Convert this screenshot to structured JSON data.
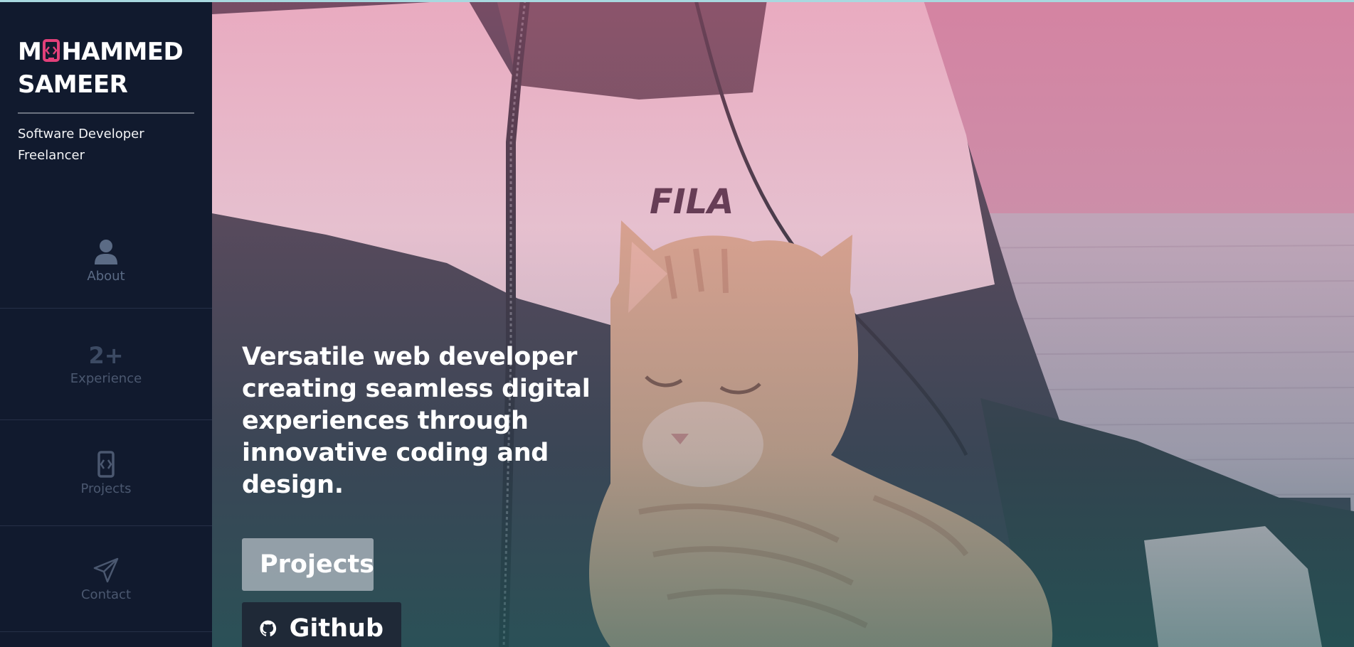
{
  "brand": {
    "name_line1_before": "M",
    "name_line1_after": "HAMMED",
    "name_line2": "SAMEER",
    "role_line1": "Software Developer",
    "role_line2": "Freelancer",
    "accent_color": "#e2407a"
  },
  "nav": {
    "about": {
      "label": "About",
      "icon": "user-icon"
    },
    "experience": {
      "stat": "2+",
      "label": "Experience"
    },
    "projects": {
      "label": "Projects",
      "icon": "code-device-icon"
    },
    "contact": {
      "label": "Contact",
      "icon": "paper-plane-icon"
    }
  },
  "hero": {
    "tagline": "Versatile web developer creating seamless digital experiences through innovative coding and design.",
    "projects_button": "Projects",
    "github_button": "Github",
    "github_icon": "github-icon"
  }
}
